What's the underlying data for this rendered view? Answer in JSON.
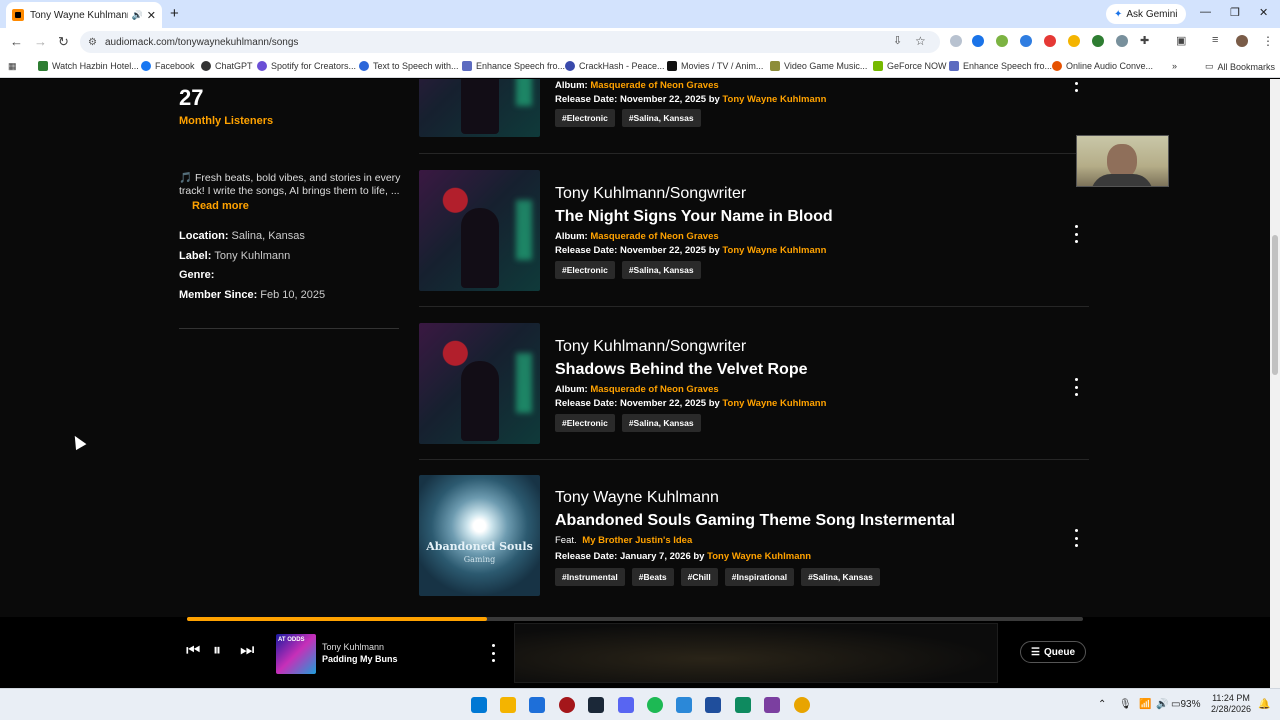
{
  "browser": {
    "tab_title": "Tony Wayne Kuhlmann - Li",
    "gemini_label": "Ask Gemini",
    "url": "audiomack.com/tonywaynekuhlmann/songs",
    "bookmarks": [
      "Watch Hazbin Hotel...",
      "Facebook",
      "ChatGPT",
      "Spotify for Creators...",
      "Text to Speech with...",
      "Enhance Speech fro...",
      "CrackHash - Peace...",
      "Movies / TV / Anim...",
      "Video Game Music...",
      "GeForce NOW",
      "Enhance Speech fro...",
      "Online Audio Conve..."
    ],
    "all_bookmarks": "All Bookmarks"
  },
  "sidebar": {
    "listeners_count": "27",
    "listeners_label": "Monthly Listeners",
    "bio": "🎵 Fresh beats, bold vibes, and stories in every track! I write the songs, AI brings them to life, ...",
    "read_more": "Read more",
    "location_label": "Location:",
    "location_value": "Salina, Kansas",
    "label_label": "Label:",
    "label_value": "Tony Kuhlmann",
    "genre_label": "Genre:",
    "member_label": "Member Since:",
    "member_value": "Feb 10, 2025"
  },
  "songs": [
    {
      "artist": "",
      "title": "",
      "album_label": "Album:",
      "album": "Masquerade of Neon Graves",
      "release_label": "Release Date:",
      "release_date": "November 22, 2025",
      "by": "by",
      "by_artist": "Tony Wayne Kuhlmann",
      "tags": [
        "#Electronic",
        "#Salina, Kansas"
      ]
    },
    {
      "artist": "Tony Kuhlmann/Songwriter",
      "title": "The Night Signs Your Name in Blood",
      "album_label": "Album:",
      "album": "Masquerade of Neon Graves",
      "release_label": "Release Date:",
      "release_date": "November 22, 2025",
      "by": "by",
      "by_artist": "Tony Wayne Kuhlmann",
      "tags": [
        "#Electronic",
        "#Salina, Kansas"
      ]
    },
    {
      "artist": "Tony Kuhlmann/Songwriter",
      "title": "Shadows Behind the Velvet Rope",
      "album_label": "Album:",
      "album": "Masquerade of Neon Graves",
      "release_label": "Release Date:",
      "release_date": "November 22, 2025",
      "by": "by",
      "by_artist": "Tony Wayne Kuhlmann",
      "tags": [
        "#Electronic",
        "#Salina, Kansas"
      ]
    },
    {
      "artist": "Tony Wayne Kuhlmann",
      "title": "Abandoned Souls Gaming Theme Song Instermental",
      "feat_label": "Feat.",
      "feat": "My Brother Justin's Idea",
      "release_label": "Release Date:",
      "release_date": "January 7, 2026",
      "by": "by",
      "by_artist": "Tony Wayne Kuhlmann",
      "tags": [
        "#Instrumental",
        "#Beats",
        "#Chill",
        "#Inspirational",
        "#Salina, Kansas"
      ],
      "art_title": "Abandoned Souls",
      "art_subtitle": "Gaming"
    }
  ],
  "player": {
    "progress": 0.335,
    "artist": "Tony Kuhlmann",
    "title": "Padding My Buns",
    "queue_label": "Queue"
  },
  "taskbar": {
    "battery": "93%",
    "time": "11:24 PM",
    "date": "2/28/2026"
  },
  "colors": {
    "accent": "#ffa200",
    "background": "#0a0a0a",
    "tag_bg": "#2a2a2a"
  }
}
